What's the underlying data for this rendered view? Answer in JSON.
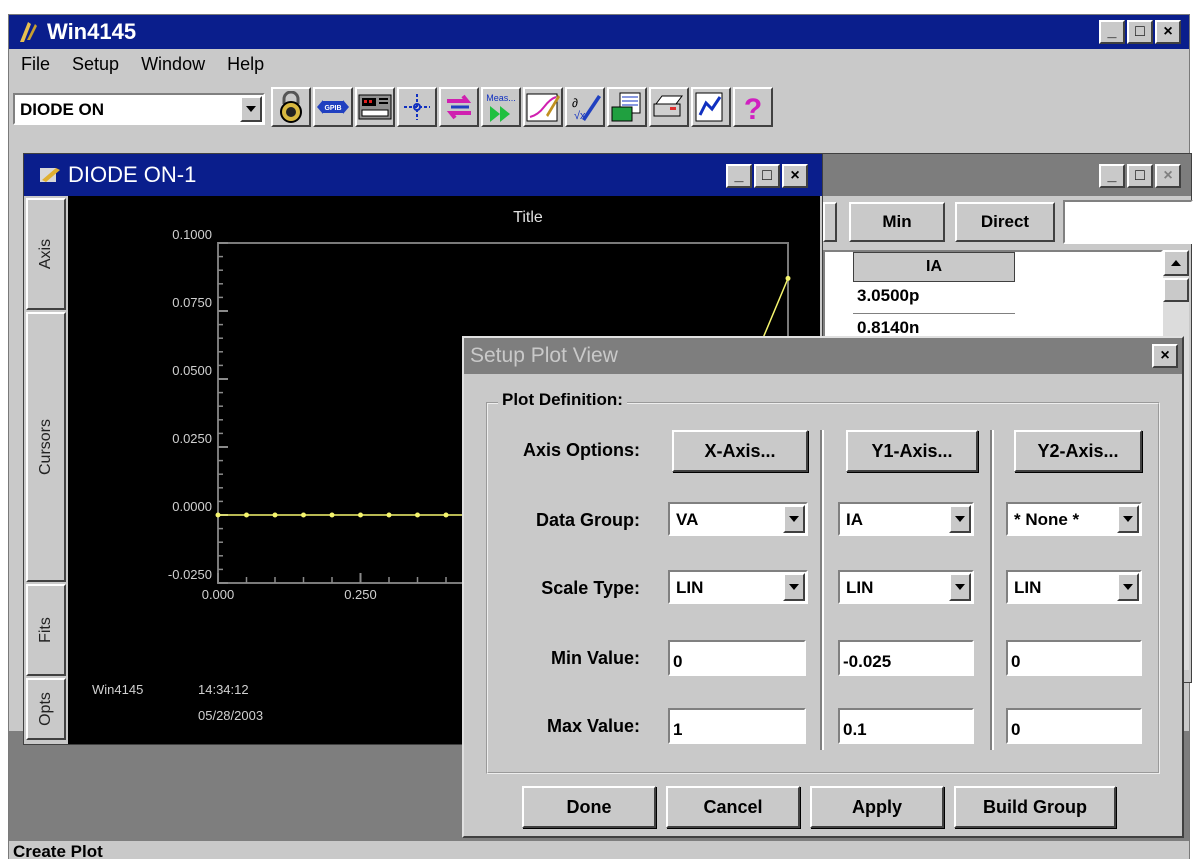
{
  "app": {
    "title": "Win4145",
    "menu": [
      "File",
      "Setup",
      "Window",
      "Help"
    ],
    "preset": "DIODE ON",
    "toolbar_icons": [
      "lock-icon",
      "gpib-icon",
      "instrument-icon",
      "crosshair-icon",
      "swap-icon",
      "measure-icon",
      "graph-icon",
      "formula-icon",
      "export-icon",
      "printer-icon",
      "report-icon",
      "help-icon"
    ],
    "toolbar_labels": {
      "gpib": "GPIB",
      "measure": "Meas..."
    },
    "help_glyph": "?",
    "status": "Create Plot"
  },
  "window_controls": {
    "minimize": "_",
    "maximize": "□",
    "close": "×"
  },
  "plot_window": {
    "title": "DIODE ON-1",
    "side_tabs": [
      "Axis",
      "Cursors",
      "Fits",
      "Opts"
    ],
    "footer": {
      "app": "Win4145",
      "time": "14:34:12",
      "date": "05/28/2003"
    }
  },
  "chart_data": {
    "type": "line",
    "title": "Title",
    "xlabel": "",
    "ylabel": "",
    "xlim": [
      0,
      1
    ],
    "ylim": [
      -0.025,
      0.1
    ],
    "x_ticks": [
      "0.000",
      "0.250"
    ],
    "y_ticks": [
      "0.1000",
      "0.0750",
      "0.0500",
      "0.0250",
      "0.0000",
      "-0.0250"
    ],
    "series": [
      {
        "x": [
          0,
          0.05,
          0.1,
          0.15,
          0.2,
          0.25,
          0.3,
          0.35,
          0.4,
          0.45,
          0.95,
          1.0
        ],
        "y": [
          0,
          0,
          0,
          0,
          0,
          0,
          0,
          0,
          0,
          0,
          0.062,
          0.087
        ],
        "color": "#f5f56e"
      }
    ]
  },
  "data_window": {
    "buttons": [
      "Min",
      "Direct"
    ],
    "column": "IA",
    "rows": [
      "3.0500p",
      "0.8140n"
    ]
  },
  "dialog": {
    "title": "Setup Plot View",
    "group_label": "Plot Definition:",
    "row_labels": {
      "axis_options": "Axis Options:",
      "data_group": "Data Group:",
      "scale_type": "Scale Type:",
      "min_value": "Min Value:",
      "max_value": "Max Value:"
    },
    "columns": [
      {
        "axis_button": "X-Axis...",
        "data_group": "VA",
        "scale_type": "LIN",
        "min": "0",
        "max": "1"
      },
      {
        "axis_button": "Y1-Axis...",
        "data_group": "IA",
        "scale_type": "LIN",
        "min": "-0.025",
        "max": "0.1"
      },
      {
        "axis_button": "Y2-Axis...",
        "data_group": "* None *",
        "scale_type": "LIN",
        "min": "0",
        "max": "0"
      }
    ],
    "buttons": {
      "done": "Done",
      "cancel": "Cancel",
      "apply": "Apply",
      "build_group": "Build Group"
    }
  }
}
